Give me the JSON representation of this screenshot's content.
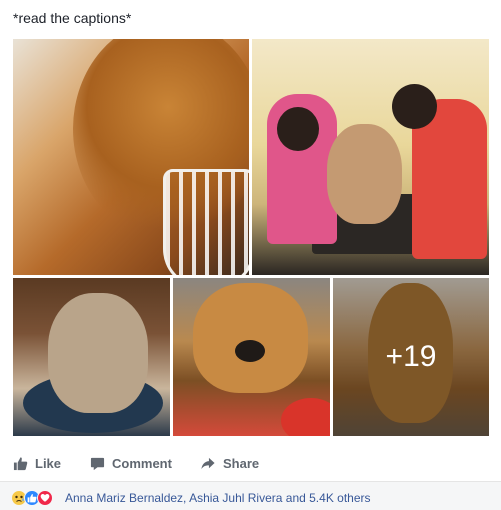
{
  "post": {
    "caption": "*read the captions*"
  },
  "photos": {
    "more_count": "+19"
  },
  "actions": {
    "like_label": "Like",
    "comment_label": "Comment",
    "share_label": "Share"
  },
  "reactions": {
    "icons": [
      "sad-reaction-icon",
      "like-reaction-icon",
      "love-reaction-icon"
    ],
    "summary": "Anna Mariz Bernaldez, Ashia Juhl Rivera and 5.4K others"
  },
  "colors": {
    "link": "#385898",
    "action_text": "#606770",
    "like_blue": "#2d88ff",
    "love_red": "#f0284a",
    "sad_yellow": "#f7c948"
  }
}
